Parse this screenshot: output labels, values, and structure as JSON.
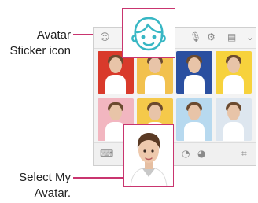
{
  "callouts": {
    "sticker_icon_text": "Avatar\nSticker icon",
    "select_avatar_text": "Select My\nAvatar."
  },
  "colors": {
    "accent": "#c9356f",
    "sticker_icon": "#38b7c4"
  },
  "toolbar": {
    "icons": [
      "emoji-sticker-icon",
      "microphone-icon",
      "settings-icon",
      "clipboard-icon",
      "chevron-down-icon"
    ]
  },
  "stickers": {
    "rows": 2,
    "cols": 4,
    "backgrounds": [
      "#d93a2b",
      "#f2c14e",
      "#2a4fa0",
      "#f7d23c",
      "#f2b6c0",
      "#f5c94a",
      "#b7d9ef",
      "#dde6ef"
    ]
  },
  "bottombar": {
    "icons": [
      "keyboard-icon",
      "sticker-icon",
      "sticker-icon",
      "camera-icon"
    ]
  }
}
